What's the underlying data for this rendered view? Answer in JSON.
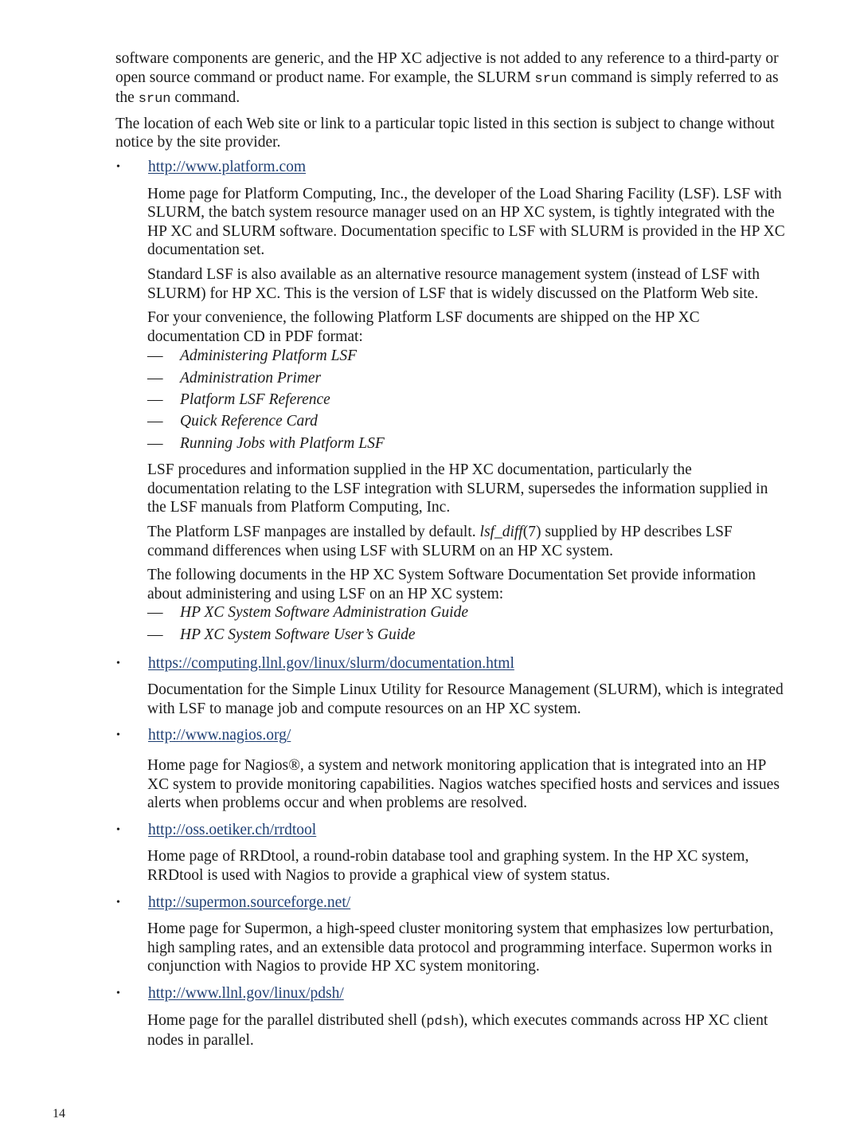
{
  "intro": {
    "p1_before": "software components are generic, and the HP XC adjective is not added to any reference to a third-party or open source command or product name. For example, the SLURM ",
    "p1_code1": "srun",
    "p1_middle": " command is simply referred to as the ",
    "p1_code2": "srun",
    "p1_after": " command.",
    "p2": "The location of each Web site or link to a particular topic listed in this section is subject to change without notice by the site provider."
  },
  "bullet_glyph": "•",
  "dash_glyph": "—",
  "entries": [
    {
      "url": "http://www.platform.com",
      "paragraphs": [
        "Home page for Platform Computing, Inc., the developer of the Load Sharing Facility (LSF). LSF with SLURM, the batch system resource manager used on an HP XC system, is tightly integrated with the HP XC and SLURM software. Documentation specific to LSF with SLURM is provided in the HP XC documentation set.",
        "Standard LSF is also available as an alternative resource management system (instead of LSF with SLURM) for HP XC. This is the version of LSF that is widely discussed on the Platform Web site.",
        "For your convenience, the following Platform LSF documents are shipped on the HP XC documentation CD in PDF format:"
      ],
      "lsf_documents": [
        "Administering Platform LSF",
        "Administration Primer",
        "Platform LSF Reference",
        "Quick Reference Card",
        "Running Jobs with Platform LSF"
      ],
      "paragraph_after_docs": "LSF procedures and information supplied in the HP XC documentation, particularly the documentation relating to the LSF integration with SLURM, supersedes the information supplied in the LSF manuals from Platform Computing, Inc.",
      "manpage_para": {
        "before": "The Platform LSF manpages are installed by default. ",
        "italic": "lsf_diff",
        "after": "(7) supplied by HP describes LSF command differences when using LSF with SLURM on an HP XC system."
      },
      "hpxc_intro": "The following documents in the HP XC System Software Documentation Set provide information about administering and using LSF on an HP XC system:",
      "hpxc_documents": [
        "HP XC System Software Administration Guide",
        "HP XC System Software User’s Guide"
      ]
    },
    {
      "url": "https://computing.llnl.gov/linux/slurm/documentation.html",
      "description": "Documentation for the Simple Linux Utility for Resource Management (SLURM), which is integrated with LSF to manage job and compute resources on an HP XC system."
    },
    {
      "url": "http://www.nagios.org/",
      "description": "Home page for Nagios®, a system and network monitoring application that is integrated into an HP XC system to provide monitoring capabilities. Nagios watches specified hosts and services and issues alerts when problems occur and when problems are resolved."
    },
    {
      "url": "http://oss.oetiker.ch/rrdtool",
      "description": "Home page of RRDtool, a round-robin database tool and graphing system. In the HP XC system, RRDtool is used with Nagios to provide a graphical view of system status."
    },
    {
      "url": "http://supermon.sourceforge.net/",
      "description": "Home page for Supermon, a high-speed cluster monitoring system that emphasizes low perturbation, high sampling rates, and an extensible data protocol and programming interface. Supermon works in conjunction with Nagios to provide HP XC system monitoring."
    },
    {
      "url": "http://www.llnl.gov/linux/pdsh/",
      "description_before": "Home page for the parallel distributed shell (",
      "description_code": "pdsh",
      "description_after": "), which executes commands across HP XC client nodes in parallel."
    }
  ],
  "page_number": "14",
  "colors": {
    "link": "#1f3f73",
    "text": "#1a1a1a"
  }
}
